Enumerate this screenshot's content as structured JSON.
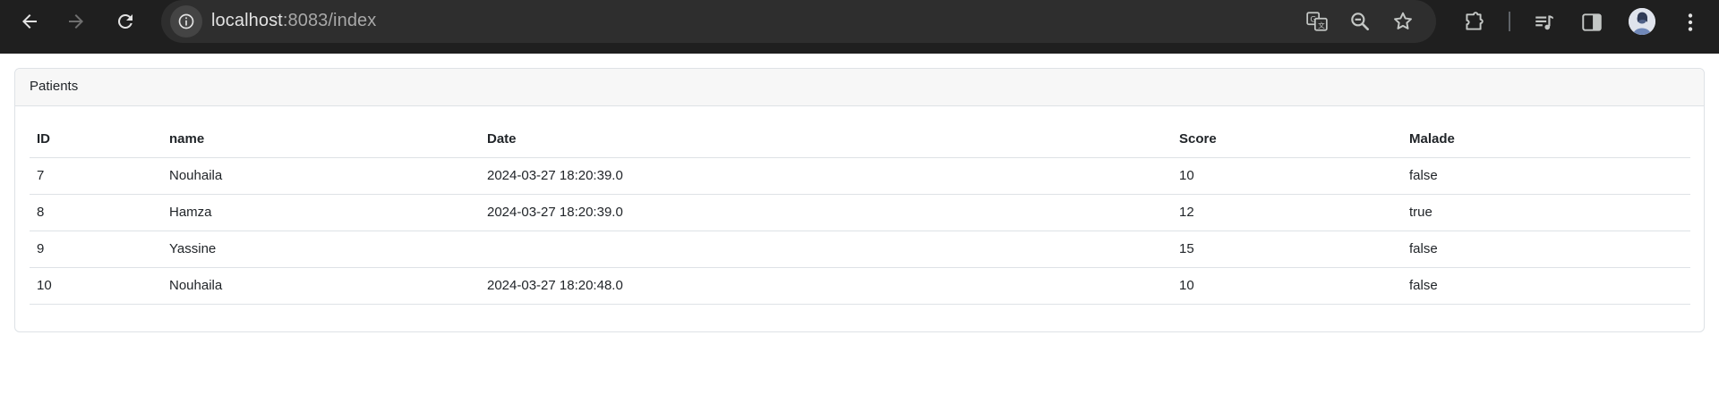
{
  "browser": {
    "url_host": "localhost",
    "url_rest": ":8083/index",
    "icons": [
      "back-icon",
      "forward-icon",
      "reload-icon",
      "site-info-icon",
      "translate-icon",
      "zoom-icon",
      "bookmark-star-icon",
      "extensions-icon",
      "media-queue-icon",
      "side-panel-icon",
      "profile-avatar",
      "kebab-menu-icon"
    ]
  },
  "card": {
    "title": "Patients"
  },
  "table": {
    "headers": [
      "ID",
      "name",
      "Date",
      "Score",
      "Malade"
    ],
    "rows": [
      [
        "7",
        "Nouhaila",
        "2024-03-27 18:20:39.0",
        "10",
        "false"
      ],
      [
        "8",
        "Hamza",
        "2024-03-27 18:20:39.0",
        "12",
        "true"
      ],
      [
        "9",
        "Yassine",
        "",
        "15",
        "false"
      ],
      [
        "10",
        "Nouhaila",
        "2024-03-27 18:20:48.0",
        "10",
        "false"
      ]
    ]
  },
  "colors": {
    "chrome": "#1f1f1f",
    "omnibox": "#2e2e2e",
    "border": "#dee2e6",
    "header_bg": "#f7f7f7"
  }
}
